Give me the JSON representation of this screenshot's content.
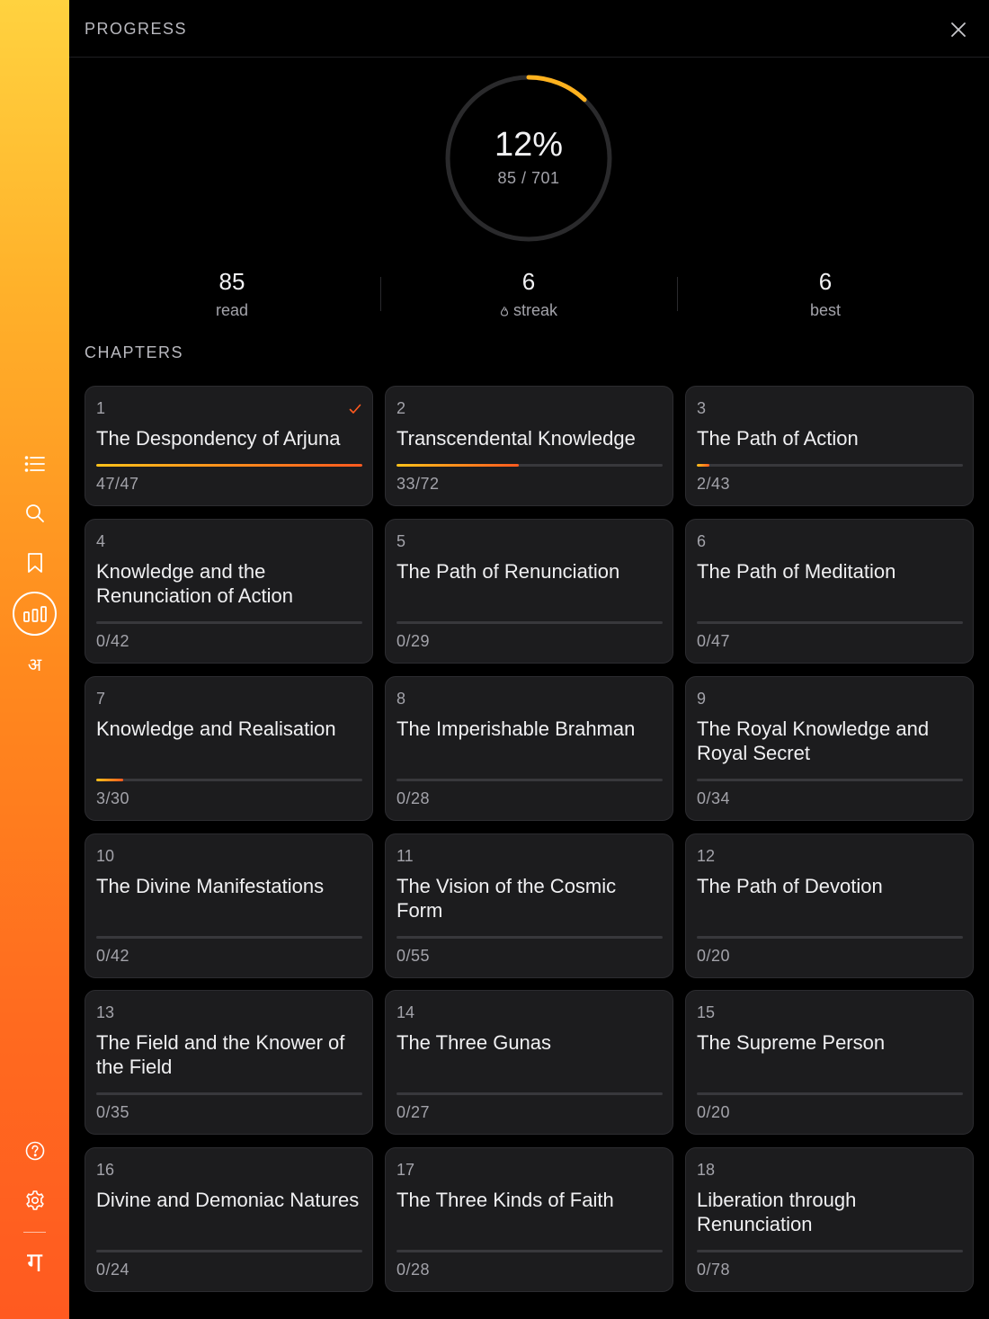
{
  "sidebar": {
    "items": [
      {
        "icon": "list-icon"
      },
      {
        "icon": "search-icon"
      },
      {
        "icon": "bookmark-icon"
      },
      {
        "icon": "progress-chart-icon",
        "active": true
      },
      {
        "icon": "devanagari-a-icon",
        "glyph": "अ"
      },
      {
        "icon": "help-icon"
      },
      {
        "icon": "settings-icon"
      },
      {
        "icon": "devanagari-ga-logo-icon",
        "glyph": "ग"
      }
    ]
  },
  "header": {
    "title": "PROGRESS",
    "close_icon": "close-icon"
  },
  "summary": {
    "percent_label": "12%",
    "progress_fraction": 0.1212,
    "count_label": "85 / 701",
    "stats": [
      {
        "value": "85",
        "label": "read"
      },
      {
        "value": "6",
        "label": "streak",
        "icon": "flame-icon"
      },
      {
        "value": "6",
        "label": "best"
      }
    ]
  },
  "chapters_title": "CHAPTERS",
  "colors": {
    "accent_start": "#ffc21a",
    "accent_end": "#ff5a1f",
    "card_bg": "#1c1c1e"
  },
  "chapters": [
    {
      "num": "1",
      "title": "The Despondency of Arjuna",
      "read": 47,
      "total": 47,
      "count": "47/47",
      "complete": true
    },
    {
      "num": "2",
      "title": "Transcendental Knowledge",
      "read": 33,
      "total": 72,
      "count": "33/72"
    },
    {
      "num": "3",
      "title": "The Path of Action",
      "read": 2,
      "total": 43,
      "count": "2/43"
    },
    {
      "num": "4",
      "title": "Knowledge and the Renunciation of Action",
      "read": 0,
      "total": 42,
      "count": "0/42"
    },
    {
      "num": "5",
      "title": "The Path of Renunciation",
      "read": 0,
      "total": 29,
      "count": "0/29"
    },
    {
      "num": "6",
      "title": "The Path of Meditation",
      "read": 0,
      "total": 47,
      "count": "0/47"
    },
    {
      "num": "7",
      "title": "Knowledge and Realisation",
      "read": 3,
      "total": 30,
      "count": "3/30"
    },
    {
      "num": "8",
      "title": "The Imperishable Brahman",
      "read": 0,
      "total": 28,
      "count": "0/28"
    },
    {
      "num": "9",
      "title": "The Royal Knowledge and Royal Secret",
      "read": 0,
      "total": 34,
      "count": "0/34"
    },
    {
      "num": "10",
      "title": "The Divine Manifestations",
      "read": 0,
      "total": 42,
      "count": "0/42"
    },
    {
      "num": "11",
      "title": "The Vision of the Cosmic Form",
      "read": 0,
      "total": 55,
      "count": "0/55"
    },
    {
      "num": "12",
      "title": "The Path of Devotion",
      "read": 0,
      "total": 20,
      "count": "0/20"
    },
    {
      "num": "13",
      "title": "The Field and the Knower of the Field",
      "read": 0,
      "total": 35,
      "count": "0/35"
    },
    {
      "num": "14",
      "title": "The Three Gunas",
      "read": 0,
      "total": 27,
      "count": "0/27"
    },
    {
      "num": "15",
      "title": "The Supreme Person",
      "read": 0,
      "total": 20,
      "count": "0/20"
    },
    {
      "num": "16",
      "title": "Divine and Demoniac Natures",
      "read": 0,
      "total": 24,
      "count": "0/24"
    },
    {
      "num": "17",
      "title": "The Three Kinds of Faith",
      "read": 0,
      "total": 28,
      "count": "0/28"
    },
    {
      "num": "18",
      "title": "Liberation through Renunciation",
      "read": 0,
      "total": 78,
      "count": "0/78"
    }
  ]
}
